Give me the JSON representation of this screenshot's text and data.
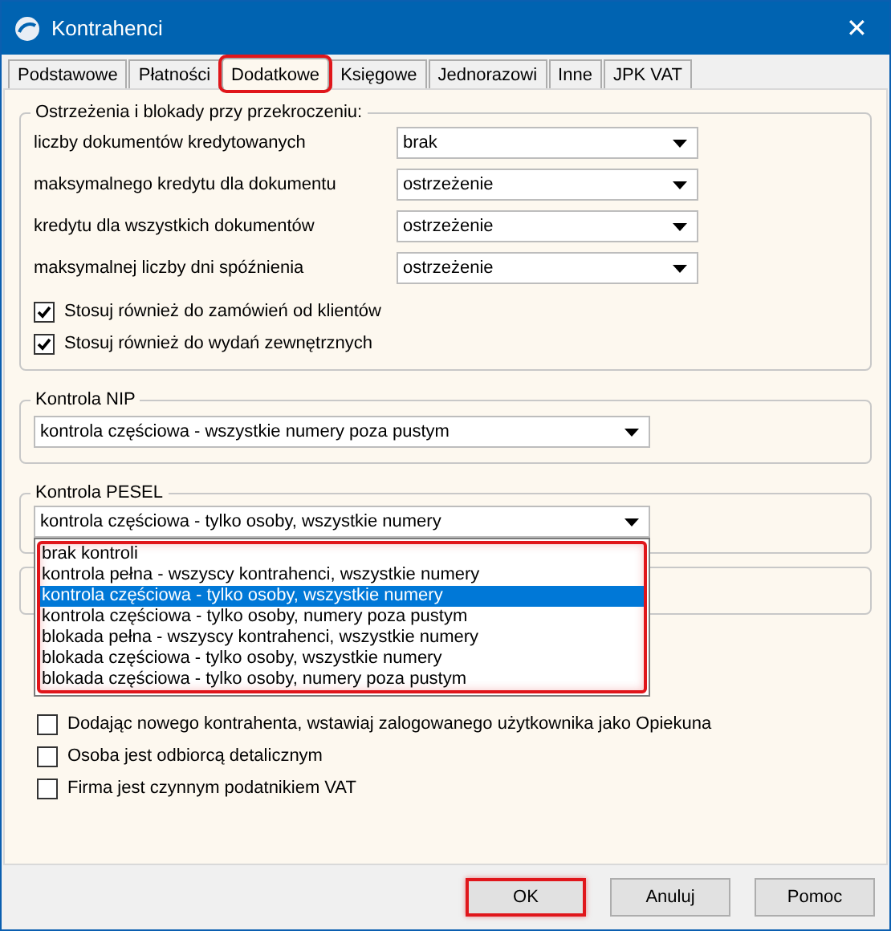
{
  "window": {
    "title": "Kontrahenci",
    "close": "✕"
  },
  "tabs": [
    {
      "label": "Podstawowe",
      "selected": false,
      "highlighted": false
    },
    {
      "label": "Płatności",
      "selected": false,
      "highlighted": false
    },
    {
      "label": "Dodatkowe",
      "selected": true,
      "highlighted": true
    },
    {
      "label": "Księgowe",
      "selected": false,
      "highlighted": false
    },
    {
      "label": "Jednorazowi",
      "selected": false,
      "highlighted": false
    },
    {
      "label": "Inne",
      "selected": false,
      "highlighted": false
    },
    {
      "label": "JPK VAT",
      "selected": false,
      "highlighted": false
    }
  ],
  "limits": {
    "title": "Ostrzeżenia i blokady przy przekroczeniu:",
    "rows": [
      {
        "label": "liczby dokumentów kredytowanych",
        "value": "brak"
      },
      {
        "label": "maksymalnego kredytu dla  dokumentu",
        "value": "ostrzeżenie"
      },
      {
        "label": "kredytu dla wszystkich dokumentów",
        "value": "ostrzeżenie"
      },
      {
        "label": "maksymalnej liczby dni spóźnienia",
        "value": "ostrzeżenie"
      }
    ],
    "checkboxes": [
      {
        "label": "Stosuj również do zamówień od klientów",
        "checked": true
      },
      {
        "label": "Stosuj również do wydań zewnętrznych",
        "checked": true
      }
    ]
  },
  "nip": {
    "title": "Kontrola NIP",
    "value": "kontrola częściowa - wszystkie numery poza pustym"
  },
  "pesel": {
    "title": "Kontrola PESEL",
    "value": "kontrola częściowa - tylko osoby, wszystkie numery",
    "expanded": true,
    "highlighted": true,
    "options": [
      {
        "label": "brak kontroli",
        "selected": false
      },
      {
        "label": "kontrola pełna - wszyscy kontrahenci, wszystkie numery",
        "selected": false
      },
      {
        "label": "kontrola częściowa - tylko osoby, wszystkie numery",
        "selected": true
      },
      {
        "label": "kontrola częściowa - tylko osoby, numery poza pustym",
        "selected": false
      },
      {
        "label": "blokada pełna - wszyscy kontrahenci, wszystkie numery",
        "selected": false
      },
      {
        "label": "blokada częściowa - tylko osoby, wszystkie numery",
        "selected": false
      },
      {
        "label": "blokada częściowa - tylko osoby, numery poza pustym",
        "selected": false
      }
    ]
  },
  "options": [
    {
      "label": "Dodając nowego kontrahenta, wstawiaj zalogowanego użytkownika jako Opiekuna",
      "checked": false
    },
    {
      "label": "Osoba jest odbiorcą detalicznym",
      "checked": false
    },
    {
      "label": "Firma jest czynnym podatnikiem VAT",
      "checked": false
    }
  ],
  "buttons": [
    {
      "label": "OK",
      "highlighted": true
    },
    {
      "label": "Anuluj",
      "highlighted": false
    },
    {
      "label": "Pomoc",
      "highlighted": false
    }
  ]
}
